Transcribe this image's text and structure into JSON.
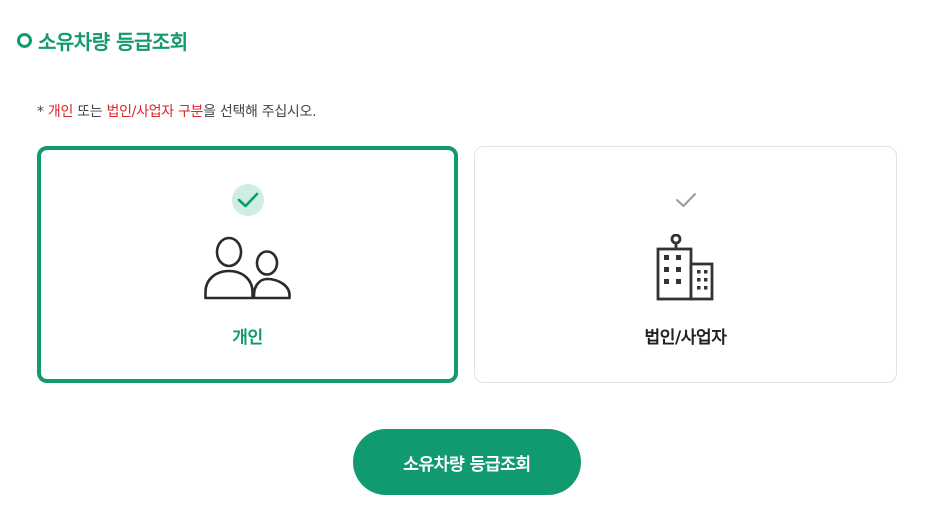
{
  "section": {
    "title": "소유차량 등급조회"
  },
  "notice": {
    "prefix": "* ",
    "highlight_personal": "개인",
    "middle": " 또는 ",
    "highlight_business": "법인/사업자 구분",
    "suffix": "을 선택해 주십시오."
  },
  "options": [
    {
      "label": "개인",
      "icon": "people-icon",
      "selected": true
    },
    {
      "label": "법인/사업자",
      "icon": "building-icon",
      "selected": false
    }
  ],
  "submit": {
    "label": "소유차량 등급조회"
  },
  "colors": {
    "accent": "#119a6f",
    "accent_light": "#cdeee1",
    "highlight_text": "#d8262f",
    "border_unselected": "#e2e2e2"
  }
}
